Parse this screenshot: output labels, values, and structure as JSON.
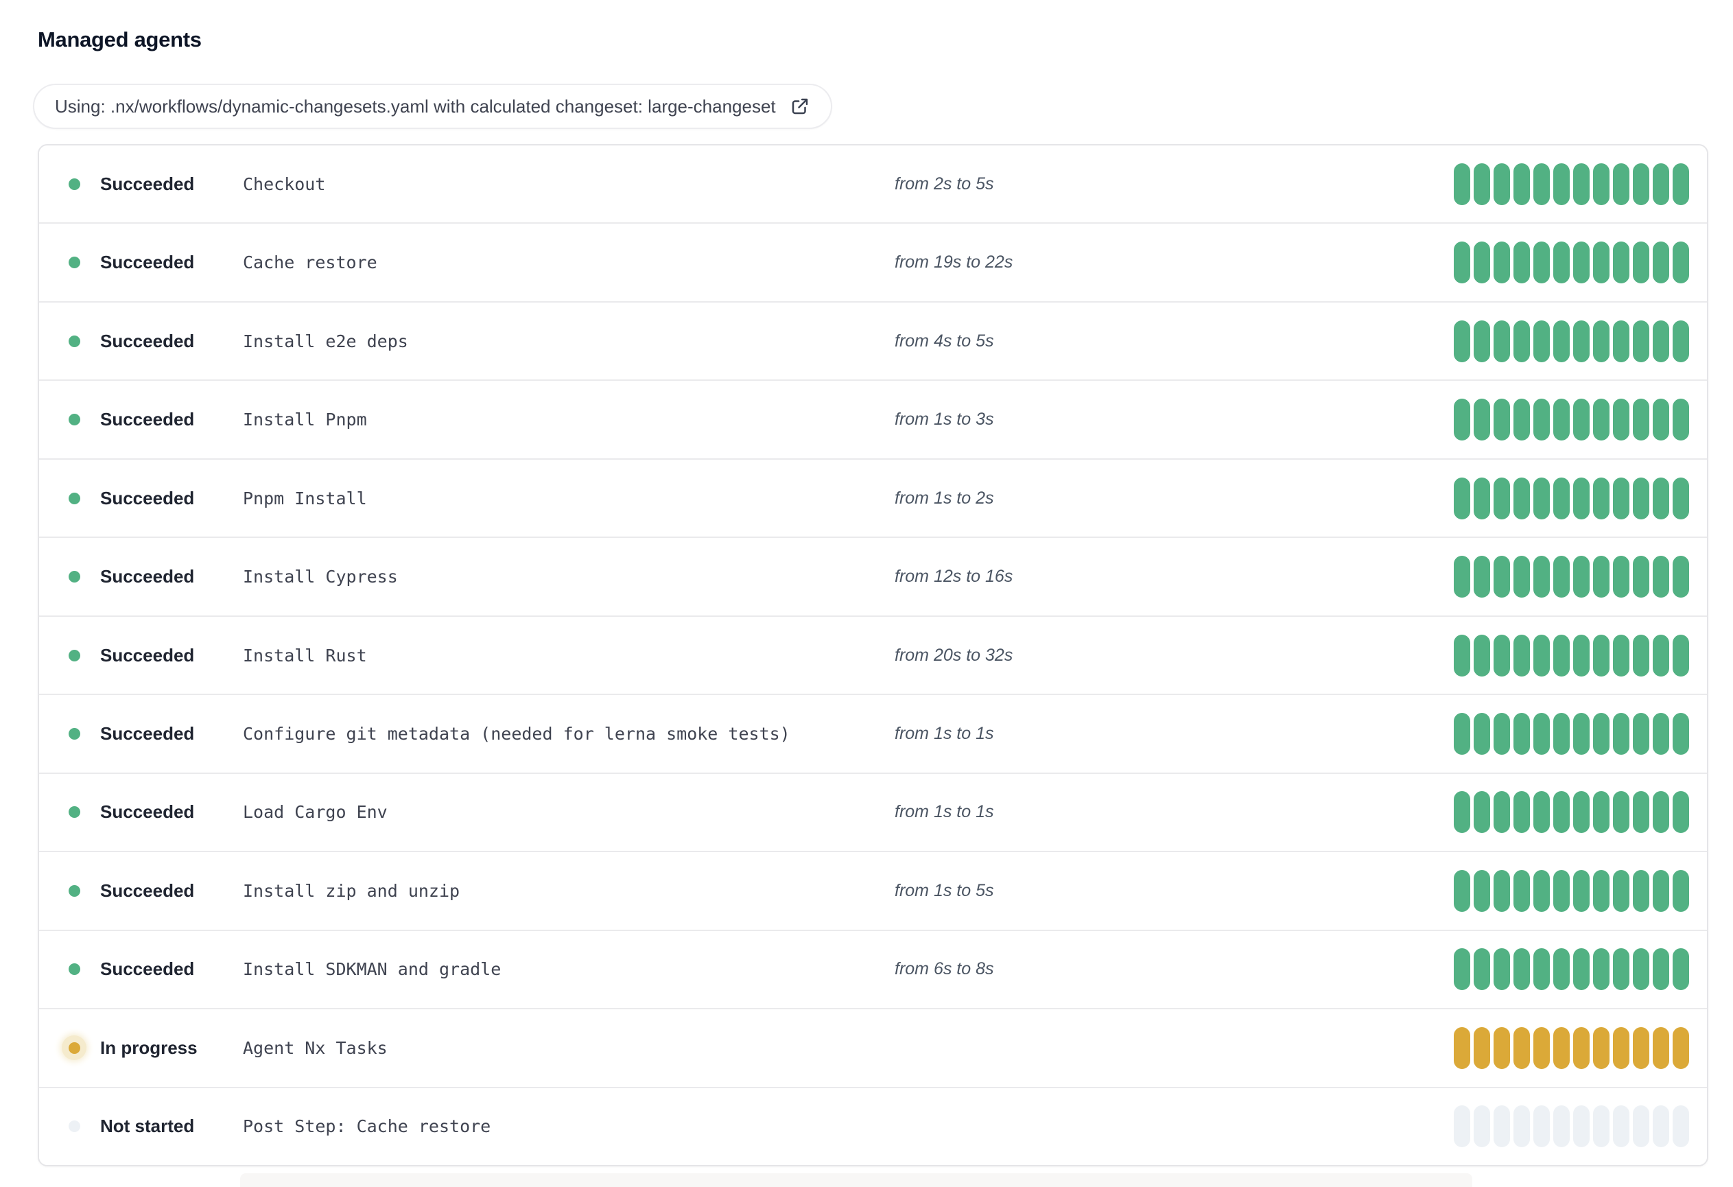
{
  "page": {
    "title": "Managed agents"
  },
  "workflow_badge": {
    "label": "Using: .nx/workflows/dynamic-changesets.yaml with calculated changeset: large-changeset",
    "icon": "external-link-icon"
  },
  "status_colors": {
    "succeeded": "#52b183",
    "in_progress": "#dba938",
    "in_progress_halo": "#f5ebcd",
    "not_started": "#edf1f5"
  },
  "progress_bar": {
    "segments": 12
  },
  "agents": [
    {
      "status": "succeeded",
      "status_label": "Succeeded",
      "step": "Checkout",
      "duration": "from 2s to 5s"
    },
    {
      "status": "succeeded",
      "status_label": "Succeeded",
      "step": "Cache restore",
      "duration": "from 19s to 22s"
    },
    {
      "status": "succeeded",
      "status_label": "Succeeded",
      "step": "Install e2e deps",
      "duration": "from 4s to 5s"
    },
    {
      "status": "succeeded",
      "status_label": "Succeeded",
      "step": "Install Pnpm",
      "duration": "from 1s to 3s"
    },
    {
      "status": "succeeded",
      "status_label": "Succeeded",
      "step": "Pnpm Install",
      "duration": "from 1s to 2s"
    },
    {
      "status": "succeeded",
      "status_label": "Succeeded",
      "step": "Install Cypress",
      "duration": "from 12s to 16s"
    },
    {
      "status": "succeeded",
      "status_label": "Succeeded",
      "step": "Install Rust",
      "duration": "from 20s to 32s"
    },
    {
      "status": "succeeded",
      "status_label": "Succeeded",
      "step": "Configure git metadata (needed for lerna smoke tests)",
      "duration": "from 1s to 1s"
    },
    {
      "status": "succeeded",
      "status_label": "Succeeded",
      "step": "Load Cargo Env",
      "duration": "from 1s to 1s"
    },
    {
      "status": "succeeded",
      "status_label": "Succeeded",
      "step": "Install zip and unzip",
      "duration": "from 1s to 5s"
    },
    {
      "status": "succeeded",
      "status_label": "Succeeded",
      "step": "Install SDKMAN and gradle",
      "duration": "from 6s to 8s"
    },
    {
      "status": "in_progress",
      "status_label": "In progress",
      "step": "Agent Nx Tasks",
      "duration": ""
    },
    {
      "status": "not_started",
      "status_label": "Not started",
      "step": "Post Step: Cache restore",
      "duration": ""
    }
  ]
}
